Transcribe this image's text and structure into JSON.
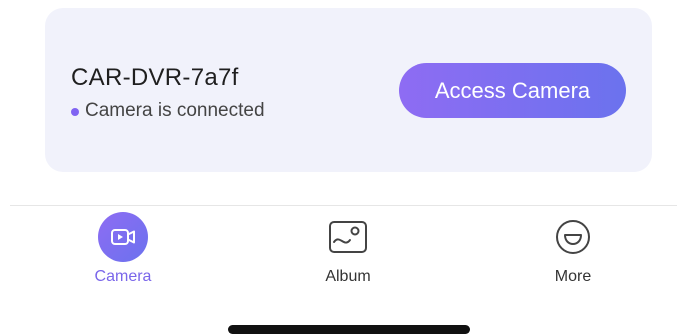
{
  "device": {
    "name": "CAR-DVR-7a7f",
    "status": "Camera is connected",
    "action_label": "Access Camera"
  },
  "tabs": [
    {
      "label": "Camera",
      "icon": "video-camera-icon",
      "active": true
    },
    {
      "label": "Album",
      "icon": "image-icon",
      "active": false
    },
    {
      "label": "More",
      "icon": "smiley-icon",
      "active": false
    }
  ],
  "colors": {
    "accent": "#7a66ea",
    "card_bg": "#f1f2fb"
  }
}
